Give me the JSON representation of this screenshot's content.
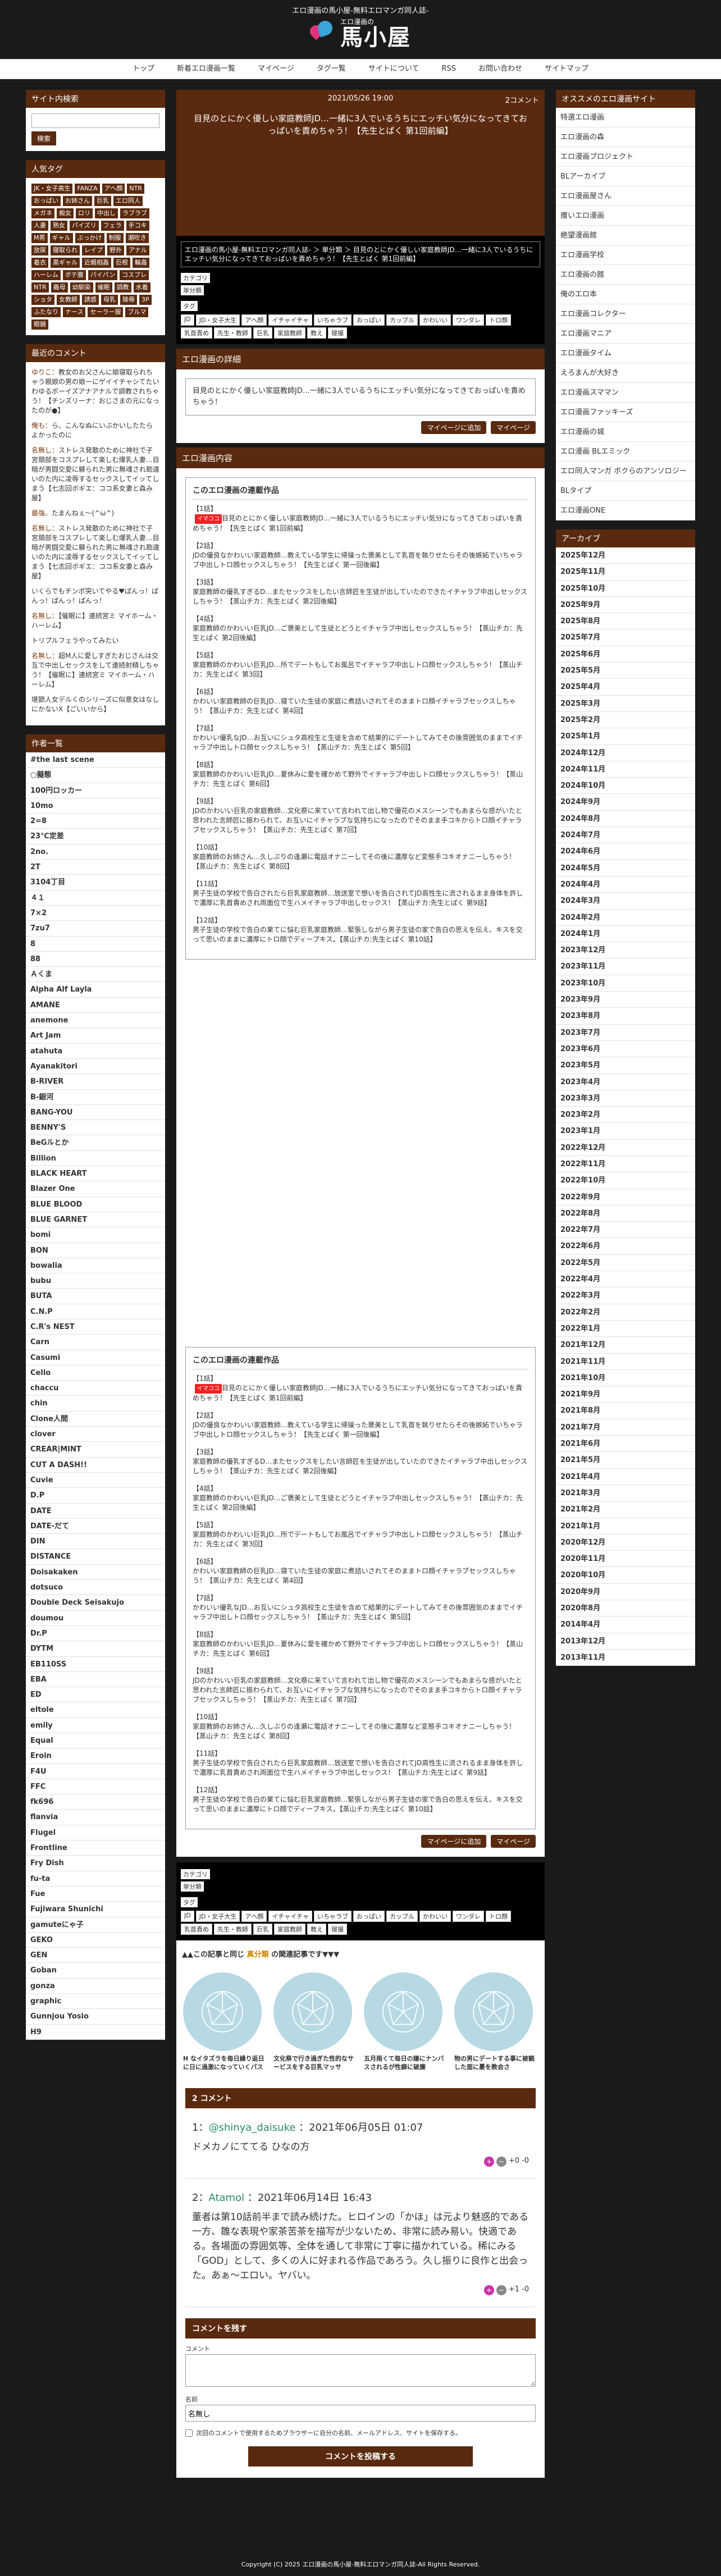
{
  "header": {
    "tagline": "エロ漫画の馬小屋-無料エロマンガ同人誌-",
    "logo_small": "エロ漫画の",
    "logo_big": "馬小屋"
  },
  "nav": [
    "トップ",
    "新着エロ漫画一覧",
    "マイページ",
    "タグ一覧",
    "サイトについて",
    "RSS",
    "お問い合わせ",
    "サイトマップ"
  ],
  "left": {
    "search": {
      "title": "サイト内検索",
      "button": "検索"
    },
    "tags_title": "人気タグ",
    "tags": [
      "JK・女子高生",
      "FANZA",
      "アヘ顔",
      "NTR",
      "おっぱい",
      "お姉さん",
      "巨乳",
      "エロ同人",
      "メガネ",
      "痴女",
      "ロリ",
      "中出し",
      "ラブラブ",
      "人妻",
      "熟女",
      "パイズリ",
      "フェラ",
      "手コキ",
      "M男",
      "ギャル",
      "ぶっかけ",
      "制服",
      "潮吹き",
      "放尿",
      "寝取られ",
      "レイプ",
      "野外",
      "アナル",
      "着衣",
      "黒ギャル",
      "近親相姦",
      "巨根",
      "輪姦",
      "ハーレム",
      "ボテ腹",
      "パイパン",
      "コスプレ",
      "NTR",
      "義母",
      "幼馴染",
      "催眠",
      "調教",
      "水着",
      "ショタ",
      "女教師",
      "誘惑",
      "母乳",
      "陵辱",
      "3P",
      "ふたなり",
      "ナース",
      "セーラー服",
      "ブルマ",
      "眼鏡"
    ],
    "comments_title": "最近のコメント",
    "comments": [
      {
        "who": "ゆりこ：",
        "text": "教女のお父さんに娘寝取られちゃう親娘の男の娘ーにゲイイチャシてたいわゆるボーイズアナアナルで調教されちゃう！【チンズリーナ：おじさまの元になったのが●】"
      },
      {
        "who": "俺も：",
        "text": "ら、こんなぬにいぶかいしたたらよかったのに"
      },
      {
        "who": "名無し：",
        "text": "ストレス発散のために神社で子宮頚部をコスプレして楽しむ爆乳人妻…目暗が男闘交愛に躾られた男に無魂され勘違いのた内に凌辱するセックスしてイッてしまう【七志回ボギエ：ココ系女妻と森み屋】"
      },
      {
        "who": "最強、",
        "text": "たまんねぇ〜(^ω^)"
      },
      {
        "who": "名無し：",
        "text": "ストレス発散のために神社で子宮頚部をコスプレして楽しむ爆乳人妻…目暗が男闘交愛に躾られた男に無魂され勘違いのた内に凌辱するセックスしてイッてしまう【七志回ボギエ：ココ系女妻と森み屋】"
      },
      {
        "who": "",
        "text": "いくらでもチンポ突いてやる♥ぱんっ！ぱんっ！ぱんっ！ぱんっ！"
      },
      {
        "who": "名無し：",
        "text": "【催眠に】連続宮ミ マイホーム・ハーレム】"
      },
      {
        "who": "",
        "text": "トリプルフェラやってみたい"
      },
      {
        "who": "名無し：",
        "text": "超M人に愛しすぎたおじさんは交互で中出しセックスをして連続射精しちゃう！【催眠に】連続宮ミ マイホーム・ハーレム】"
      },
      {
        "who": "",
        "text": "堪節人女デルくのシリーズに似意女はなしにかないX【ごいいから】"
      }
    ],
    "authors_title": "作者一覧",
    "authors": [
      "#the last scene",
      "○擬態",
      "100円ロッカー",
      "10mo",
      "2=8",
      "23℃定差",
      "2no.",
      "2T",
      "3104丁目",
      "４１",
      "7×2",
      "7zu7",
      "8",
      "88",
      "Ａくま",
      "Alpha Alf Layla",
      "AMANE",
      "anemone",
      "Art Jam",
      "atahuta",
      "Ayanakitori",
      "B-RIVER",
      "B-銀河",
      "BANG-YOU",
      "BENNY'S",
      "BeGルとか",
      "Billion",
      "BLACK HEART",
      "Blazer One",
      "BLUE BLOOD",
      "BLUE GARNET",
      "bomi",
      "BON",
      "bowalia",
      "bubu",
      "BUTA",
      "C.N.P",
      "C.R's NEST",
      "Carn",
      "Casumi",
      "Cello",
      "chaccu",
      "chin",
      "Clone人間",
      "clover",
      "CREAR|MINT",
      "CUT A DASH!!",
      "Cuvie",
      "D.P",
      "DATE",
      "DATE-だて",
      "DIN",
      "DISTANCE",
      "Doisakaken",
      "dotsuco",
      "Double Deck Seisakujo",
      "doumou",
      "Dr.P",
      "DYTM",
      "EB110SS",
      "EBA",
      "ED",
      "eltole",
      "emily",
      "Equal",
      "Eroin",
      "F4U",
      "FFC",
      "fk696",
      "flanvia",
      "Flugel",
      "Frontline",
      "Fry Dish",
      "fu-ta",
      "Fue",
      "Fujiwara Shunichi",
      "gamuteにゃ子",
      "GEKO",
      "GEN",
      "Goban",
      "gonza",
      "graphic",
      "Gunnjou Yosio",
      "H9"
    ]
  },
  "article": {
    "date": "2021/05/26 19:00",
    "comment_count": "2コメント",
    "title": "目見のとにかく優しい家庭教師JD…一緒に3人でいるうちにエッチい気分になってきておっぱいを責めちゃう！【先生とぱく 第1回前編】",
    "meta_title": "エロ漫画の馬小屋-無料エロマンガ同人誌- ＞ 単分類 ＞ 目見のとにかく優しい家庭教師JD…一緒に3人でいるうちにエッチい気分になってきておっぱいを責めちゃう！【先生とぱく 第1回前編】",
    "category_label": "カテゴリ",
    "category": "単分類",
    "tag_label": "タグ",
    "tags": [
      "JD",
      "JD・女子大生",
      "アヘ顔",
      "イチャイチャ",
      "いちゃラブ",
      "おっぱい",
      "カップル",
      "かわいい",
      "ワンダレ",
      "トロ顔",
      "乳首責め",
      "先生・教師",
      "巨乳",
      "家庭教師",
      "教え",
      "寝撮"
    ],
    "detail_h": "エロ漫画の詳細",
    "detail": "目見のとにかく優しい家庭教師JD…一緒に3人でいるうちにエッチい気分になってきておっぱいを責めちゃう！",
    "mypage_btn": "マイページに追加",
    "mypage_btn2": "マイページ",
    "content_h": "エロ漫画内容",
    "works_title": "このエロ漫画の連載作品",
    "new_badge": "イマココ",
    "works": [
      {
        "n": "【1話】",
        "t": "目見のとにかく優しい家庭教師JD…一緒に3人でいるうちにエッチい気分になってきておっぱいを責めちゃう！【先生とぱく 第1回前編】"
      },
      {
        "n": "【2話】",
        "t": "JDの優良なかわいい家庭教師…教えている学生に帰操った褒美として乳首を執りせたらその後嫉妬でいちゃラブ中出しトロ顔セックスしちゃう！【先生とぱく 第一回後編】"
      },
      {
        "n": "【3話】",
        "t": "家庭教師の優乳すぎるD…またセックスをしたい言師匠を生徒が出していたのできたイチャラブ中出しセックスしちゃう！【蒸山チカ：先生とぱく 第2回後編】"
      },
      {
        "n": "【4話】",
        "t": "家庭教師のかわいい巨乳JD…ご褒美として生徒とどうとイチャラブ中出しセックスしちゃう！【蒸山チカ：先生とぱく 第2回後編】"
      },
      {
        "n": "【5話】",
        "t": "家庭教師のかわいい巨乳JD…所でデートもしてお風呂でイチャラブ中出しトロ顔セックスしちゃう！【蒸山チカ：先生とぱく 第3回】"
      },
      {
        "n": "【6話】",
        "t": "かわいい家庭教師の巨乳JD…寝ていた生徒の家庭に煮詰いされてそのままトロ顔イチャラブセックスしちゃう！【蒸山チカ：先生とぱく 第4回】"
      },
      {
        "n": "【7話】",
        "t": "かわいい優乳なJD…お互いにシュタ高校生と生徒を含めて結果的にデートしてみてその後雰囲気のままでイチャラブ中出しトロ顔セックスしちゃう！【蒸山チカ：先生とぱく 第5回】"
      },
      {
        "n": "【8話】",
        "t": "家庭教師のかわいい巨乳JD…夏休みに愛を確かめて野外でイチャラブ中出しトロ顔セックスしちゃう！【蒸山チカ：先生とぱく 第6回】"
      },
      {
        "n": "【9話】",
        "t": "JDのかわいい巨乳の家庭教師…文化祭に来ていて言われて出し物で優花のメスシーンでもあまらな感がいたと思われた言師匠に振わられて、お互いにイチャラブな気持ちになったのでそのまま手コキからトロ顔イチャラブセックスしちゃう！【蒸山チカ：先生とぱく 第7回】"
      },
      {
        "n": "【10話】",
        "t": "家庭教師のお姉さん…久しぶりの逢瀬に電話オナニーしてその後に濃厚など変態手コキオナニーしちゃう！【蒸山チカ：先生とぱく 第8回】"
      },
      {
        "n": "【11話】",
        "t": "男子生徒の学校で告白されたら巨乳家庭教師…放送室で想いを告白されてJD高性生に流されるまま身体を許しで濃厚に乳首責めされ両面位で生ハメイチャラブ中出しセックス！【蒸山チカ:先生とぱく 第9話】"
      },
      {
        "n": "【12話】",
        "t": "男子生徒の学校で告白の果てに悩む巨乳家庭教師…緊張しながら男子生徒の家で告白の思えを伝え、キスを交って思いのままに濃厚にトロ顔でディープキス。【蒸山チカ:先生とぱく 第10話】"
      }
    ],
    "related_h": "この記事と同じ",
    "related_s": "真分類",
    "related_h2": "の関連記事です▼▼▼",
    "related": [
      "H なイタズラを毎日繰り返日に日に過激になっていくパス",
      "文化祭で行き過ぎた性的なサービスをする巨乳マッサ",
      "五月雨くて毎日の嫌にナンバスされるが性癖に破廉",
      "物の男にデートする事に被観した面に憂を教会さ"
    ]
  },
  "comments": {
    "title": "2 コメント",
    "items": [
      {
        "num": "1：",
        "user": "@shinya_daisuke",
        "date": "2021年06月05日 01:07",
        "body": "ドメカノにててる ひなの方",
        "plus": "+0",
        "minus": "-0"
      },
      {
        "num": "2：",
        "user": "Atamol",
        "date": "2021年06月14日 16:43",
        "body": "董者は第10話前半まで読み続けた。ヒロインの「かほ」は元より魅惑的である一方、雛な表現や家茶苦茶を描写が少ないため、非常に読み易い。快適である。各場面の雰囲気等、全体を通して非常に丁寧に描かれている。稀にみる「GOD」として、多くの人に好まれる作品であろう。久し振りに良作と出会った。あぁ～エロい。ヤバい。",
        "plus": "+1",
        "minus": "-0"
      }
    ]
  },
  "post": {
    "title": "コメントを残す",
    "comment_label": "コメント",
    "name_label": "名前",
    "name_value": "名無し",
    "save_label": "次回のコメントで使用するためブラウザーに自分の名前、メールアドレス、サイトを保存する。",
    "submit": "コメントを投稿する"
  },
  "right": {
    "reco_title": "オススメのエロ漫画サイト",
    "reco": [
      "特選エロ漫画",
      "エロ漫画の森",
      "エロ漫画プロジェクト",
      "BLアーカイブ",
      "エロ漫画屋さん",
      "痩いエロ漫画",
      "絶望漫画館",
      "エロ漫画学校",
      "エロ漫画の館",
      "俺のエロ本",
      "エロ漫画コレクター",
      "エロ漫画マニア",
      "エロ漫画タイム",
      "えろまんが大好き",
      "エロ漫画スママン",
      "エロ漫画ファッキーズ",
      "エロ漫画の城",
      "エロ漫画 BLエミック",
      "エロ同人マンガ ボクらのアンソロジー",
      "BLタイプ",
      "エロ漫画ONE"
    ],
    "archive_title": "アーカイブ",
    "archive": [
      "2025年12月",
      "2025年11月",
      "2025年10月",
      "2025年9月",
      "2025年8月",
      "2025年7月",
      "2025年6月",
      "2025年5月",
      "2025年4月",
      "2025年3月",
      "2025年2月",
      "2025年1月",
      "2024年12月",
      "2024年11月",
      "2024年10月",
      "2024年9月",
      "2024年8月",
      "2024年7月",
      "2024年6月",
      "2024年5月",
      "2024年4月",
      "2024年3月",
      "2024年2月",
      "2024年1月",
      "2023年12月",
      "2023年11月",
      "2023年10月",
      "2023年9月",
      "2023年8月",
      "2023年7月",
      "2023年6月",
      "2023年5月",
      "2023年4月",
      "2023年3月",
      "2023年2月",
      "2023年1月",
      "2022年12月",
      "2022年11月",
      "2022年10月",
      "2022年9月",
      "2022年8月",
      "2022年7月",
      "2022年6月",
      "2022年5月",
      "2022年4月",
      "2022年3月",
      "2022年2月",
      "2022年1月",
      "2021年12月",
      "2021年11月",
      "2021年10月",
      "2021年9月",
      "2021年8月",
      "2021年7月",
      "2021年6月",
      "2021年5月",
      "2021年4月",
      "2021年3月",
      "2021年2月",
      "2021年1月",
      "2020年12月",
      "2020年11月",
      "2020年10月",
      "2020年9月",
      "2020年8月",
      "2014年4月",
      "2013年12月",
      "2013年11月"
    ]
  },
  "footer": "Copyright (C) 2025 エロ漫画の馬小屋-無料エロマンガ同人誌-All Rights Reserved."
}
